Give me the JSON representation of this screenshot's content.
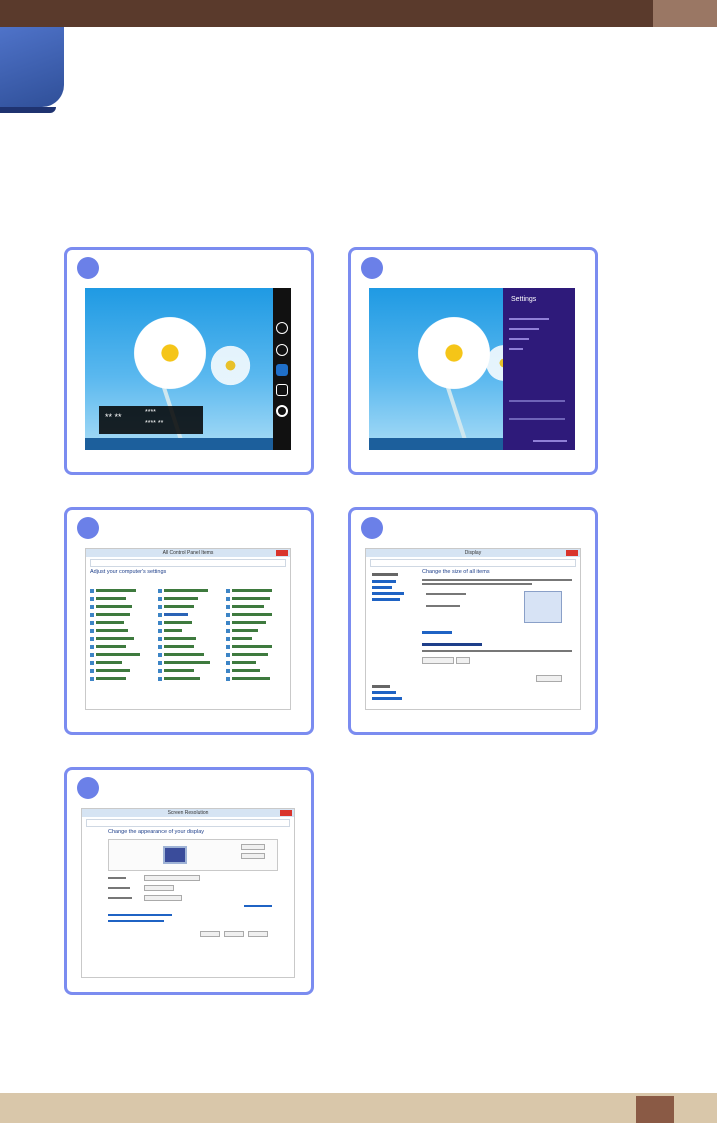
{
  "steps": [
    {
      "id": 1
    },
    {
      "id": 2,
      "settings_title": "Settings"
    },
    {
      "id": 3,
      "window_title": "All Control Panel Items",
      "heading": "Adjust your computer's settings"
    },
    {
      "id": 4,
      "window_title": "Display",
      "heading": "Change the size of all items"
    },
    {
      "id": 5,
      "window_title": "Screen Resolution",
      "heading": "Change the appearance of your display"
    }
  ],
  "colors": {
    "header": "#5a3a2c",
    "header_accent": "#9a7764",
    "chapter_tab": "#3d5fb5",
    "panel_border": "#7b8cf0",
    "step_marker": "#6b80e8",
    "footer": "#d9c7aa",
    "page_box": "#8a5a45"
  },
  "icons": [
    "search-icon",
    "share-icon",
    "start-icon",
    "devices-icon",
    "settings-icon"
  ]
}
